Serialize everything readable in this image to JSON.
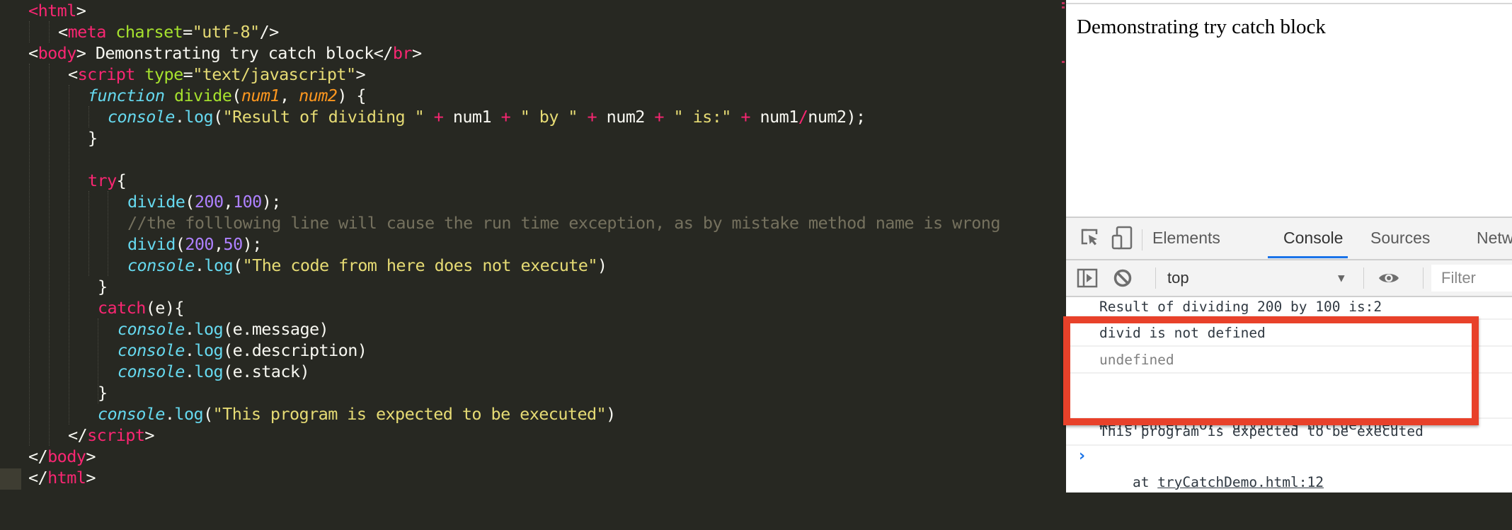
{
  "editor": {
    "lines": [
      [
        {
          "c": "tag",
          "t": "<"
        },
        {
          "c": "kw",
          "t": "html"
        },
        {
          "c": "plain",
          "t": ">"
        }
      ],
      [
        {
          "c": "plain",
          "t": "<"
        },
        {
          "c": "kw",
          "t": "meta"
        },
        {
          "c": "plain",
          "t": " "
        },
        {
          "c": "attr",
          "t": "charset"
        },
        {
          "c": "plain",
          "t": "="
        },
        {
          "c": "str",
          "t": "\"utf-8\""
        },
        {
          "c": "plain",
          "t": "/>"
        }
      ],
      [
        {
          "c": "plain",
          "t": "<"
        },
        {
          "c": "kw",
          "t": "body"
        },
        {
          "c": "plain",
          "t": "> Demonstrating try catch block</"
        },
        {
          "c": "kw",
          "t": "br"
        },
        {
          "c": "plain",
          "t": ">"
        }
      ],
      [
        {
          "c": "plain",
          "t": "<"
        },
        {
          "c": "kw",
          "t": "script"
        },
        {
          "c": "plain",
          "t": " "
        },
        {
          "c": "attr",
          "t": "type"
        },
        {
          "c": "plain",
          "t": "="
        },
        {
          "c": "str",
          "t": "\"text/javascript\""
        },
        {
          "c": "plain",
          "t": ">"
        }
      ],
      [
        {
          "c": "fnkw",
          "t": "function"
        },
        {
          "c": "plain",
          "t": " "
        },
        {
          "c": "fname",
          "t": "divide"
        },
        {
          "c": "plain",
          "t": "("
        },
        {
          "c": "param",
          "t": "num1"
        },
        {
          "c": "plain",
          "t": ", "
        },
        {
          "c": "param",
          "t": "num2"
        },
        {
          "c": "plain",
          "t": ") {"
        }
      ],
      [
        {
          "c": "obj",
          "t": "console"
        },
        {
          "c": "plain",
          "t": "."
        },
        {
          "c": "call",
          "t": "log"
        },
        {
          "c": "plain",
          "t": "("
        },
        {
          "c": "str",
          "t": "\"Result of dividing \""
        },
        {
          "c": "plain",
          "t": " "
        },
        {
          "c": "op",
          "t": "+"
        },
        {
          "c": "plain",
          "t": " num1 "
        },
        {
          "c": "op",
          "t": "+"
        },
        {
          "c": "plain",
          "t": " "
        },
        {
          "c": "str",
          "t": "\" by \""
        },
        {
          "c": "plain",
          "t": " "
        },
        {
          "c": "op",
          "t": "+"
        },
        {
          "c": "plain",
          "t": " num2 "
        },
        {
          "c": "op",
          "t": "+"
        },
        {
          "c": "plain",
          "t": " "
        },
        {
          "c": "str",
          "t": "\" is:\""
        },
        {
          "c": "plain",
          "t": " "
        },
        {
          "c": "op",
          "t": "+"
        },
        {
          "c": "plain",
          "t": " num1"
        },
        {
          "c": "op",
          "t": "/"
        },
        {
          "c": "plain",
          "t": "num2);"
        }
      ],
      [
        {
          "c": "plain",
          "t": "}"
        }
      ],
      [],
      [
        {
          "c": "kw",
          "t": "try"
        },
        {
          "c": "plain",
          "t": "{"
        }
      ],
      [
        {
          "c": "call",
          "t": "divide"
        },
        {
          "c": "plain",
          "t": "("
        },
        {
          "c": "num",
          "t": "200"
        },
        {
          "c": "plain",
          "t": ","
        },
        {
          "c": "num",
          "t": "100"
        },
        {
          "c": "plain",
          "t": ");"
        }
      ],
      [
        {
          "c": "cmt",
          "t": "//the folllowing line will cause the run time exception, as by mistake method name is wrong"
        }
      ],
      [
        {
          "c": "call",
          "t": "divid"
        },
        {
          "c": "plain",
          "t": "("
        },
        {
          "c": "num",
          "t": "200"
        },
        {
          "c": "plain",
          "t": ","
        },
        {
          "c": "num",
          "t": "50"
        },
        {
          "c": "plain",
          "t": ");"
        }
      ],
      [
        {
          "c": "obj",
          "t": "console"
        },
        {
          "c": "plain",
          "t": "."
        },
        {
          "c": "call",
          "t": "log"
        },
        {
          "c": "plain",
          "t": "("
        },
        {
          "c": "str",
          "t": "\"The code from here does not execute\""
        },
        {
          "c": "plain",
          "t": ")"
        }
      ],
      [
        {
          "c": "plain",
          "t": "}"
        }
      ],
      [
        {
          "c": "kw",
          "t": "catch"
        },
        {
          "c": "plain",
          "t": "(e){"
        }
      ],
      [
        {
          "c": "obj",
          "t": "console"
        },
        {
          "c": "plain",
          "t": "."
        },
        {
          "c": "call",
          "t": "log"
        },
        {
          "c": "plain",
          "t": "(e.message)"
        }
      ],
      [
        {
          "c": "obj",
          "t": "console"
        },
        {
          "c": "plain",
          "t": "."
        },
        {
          "c": "call",
          "t": "log"
        },
        {
          "c": "plain",
          "t": "(e.description)"
        }
      ],
      [
        {
          "c": "obj",
          "t": "console"
        },
        {
          "c": "plain",
          "t": "."
        },
        {
          "c": "call",
          "t": "log"
        },
        {
          "c": "plain",
          "t": "(e.stack)"
        }
      ],
      [
        {
          "c": "plain",
          "t": "}"
        }
      ],
      [
        {
          "c": "obj",
          "t": "console"
        },
        {
          "c": "plain",
          "t": "."
        },
        {
          "c": "call",
          "t": "log"
        },
        {
          "c": "plain",
          "t": "("
        },
        {
          "c": "str",
          "t": "\"This program is expected to be executed\""
        },
        {
          "c": "plain",
          "t": ")"
        }
      ],
      [
        {
          "c": "plain",
          "t": "</"
        },
        {
          "c": "kw",
          "t": "script"
        },
        {
          "c": "plain",
          "t": ">"
        }
      ],
      [
        {
          "c": "plain",
          "t": "</"
        },
        {
          "c": "kw",
          "t": "body"
        },
        {
          "c": "plain",
          "t": ">"
        }
      ],
      [
        {
          "c": "plain",
          "t": "</"
        },
        {
          "c": "kw",
          "t": "html"
        },
        {
          "c": "plain",
          "t": ">"
        }
      ]
    ]
  },
  "browser": {
    "page_text": "Demonstrating try catch block"
  },
  "devtools": {
    "tabs": [
      "Elements",
      "Console",
      "Sources",
      "Netw"
    ],
    "active_tab": "Console",
    "context": "top",
    "filter_placeholder": "Filter",
    "icons": {
      "inspect": "inspect-element-icon",
      "device": "device-toolbar-icon",
      "sidebar": "show-sidebar-icon",
      "clear": "clear-console-icon",
      "dropdown": "dropdown-arrow-icon",
      "eye": "live-expression-icon",
      "prompt": "prompt-chevron-icon"
    },
    "messages": [
      {
        "text": "Result of dividing 200 by 100 is:2"
      },
      {
        "text": "divid is not defined"
      },
      {
        "text": "undefined"
      },
      {
        "text": "ReferenceError: divid is not defined",
        "line2_prefix": "    at ",
        "link": "tryCatchDemo.html:12"
      },
      {
        "text": "This program is expected to be executed"
      }
    ],
    "prompt_symbol": "›"
  },
  "annotation": {
    "highlight_color": "#e8412a"
  }
}
